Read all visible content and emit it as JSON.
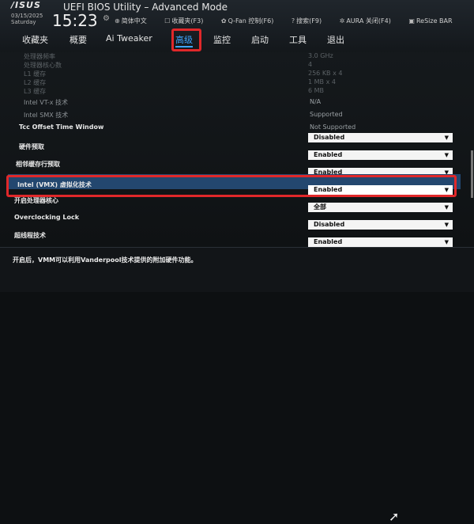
{
  "header": {
    "logo": "/ISUS",
    "title": "UEFI BIOS Utility – Advanced Mode",
    "date_line1": "03/15/2025",
    "date_line2": "Saturday",
    "time": "15:23",
    "settings_icon": "gear-icon",
    "tools": [
      {
        "icon": "globe-icon",
        "label": "简体中文"
      },
      {
        "icon": "star-icon",
        "label": "收藏夹(F3)"
      },
      {
        "icon": "fan-icon",
        "label": "Q-Fan 控制(F6)"
      },
      {
        "icon": "search-icon",
        "label": "搜索(F9)"
      },
      {
        "icon": "aura-icon",
        "label": "AURA 关闭(F4)"
      },
      {
        "icon": "bar-icon",
        "label": "ReSize BAR"
      }
    ]
  },
  "tabs": [
    {
      "label": "收藏夹",
      "active": false
    },
    {
      "label": "概要",
      "active": false
    },
    {
      "label": "Ai Tweaker",
      "active": false
    },
    {
      "label": "高级",
      "active": true
    },
    {
      "label": "监控",
      "active": false
    },
    {
      "label": "启动",
      "active": false
    },
    {
      "label": "工具",
      "active": false
    },
    {
      "label": "退出",
      "active": false
    }
  ],
  "ghost_rows": [
    {
      "label": "处理器频率",
      "value": "3.0 GHz"
    },
    {
      "label": "处理器核心数",
      "value": "4"
    },
    {
      "label": "L1 缓存",
      "value": "256 KB x 4"
    },
    {
      "label": "L2 缓存",
      "value": "1 MB x 4"
    },
    {
      "label": "L3 缓存",
      "value": "6 MB"
    }
  ],
  "info_rows": [
    {
      "label": "Intel VT-x 技术",
      "value": "N/A"
    },
    {
      "label": "Intel SMX 技术",
      "value": "Supported"
    },
    {
      "label": "Tcc Offset Time Window",
      "value": "Not Supported"
    }
  ],
  "settings": [
    {
      "label": "硬件预取",
      "value": "Disabled"
    },
    {
      "label": "相邻缓存行预取",
      "value": "Enabled"
    },
    {
      "label": "",
      "value": "Enabled"
    },
    {
      "label": "Intel (VMX) 虚拟化技术",
      "value": "Enabled",
      "highlighted": true
    },
    {
      "label": "开启处理器核心",
      "value": "全部"
    },
    {
      "label": "Overclocking Lock",
      "value": "Disabled"
    },
    {
      "label": "超线程技术",
      "value": "Enabled"
    }
  ],
  "help_text": "开启后，VMM可以利用Vanderpool技术提供的附加硬件功能。",
  "colors": {
    "accent": "#3fa5ff",
    "highlight": "#23476f",
    "annotation": "#e0282a"
  }
}
